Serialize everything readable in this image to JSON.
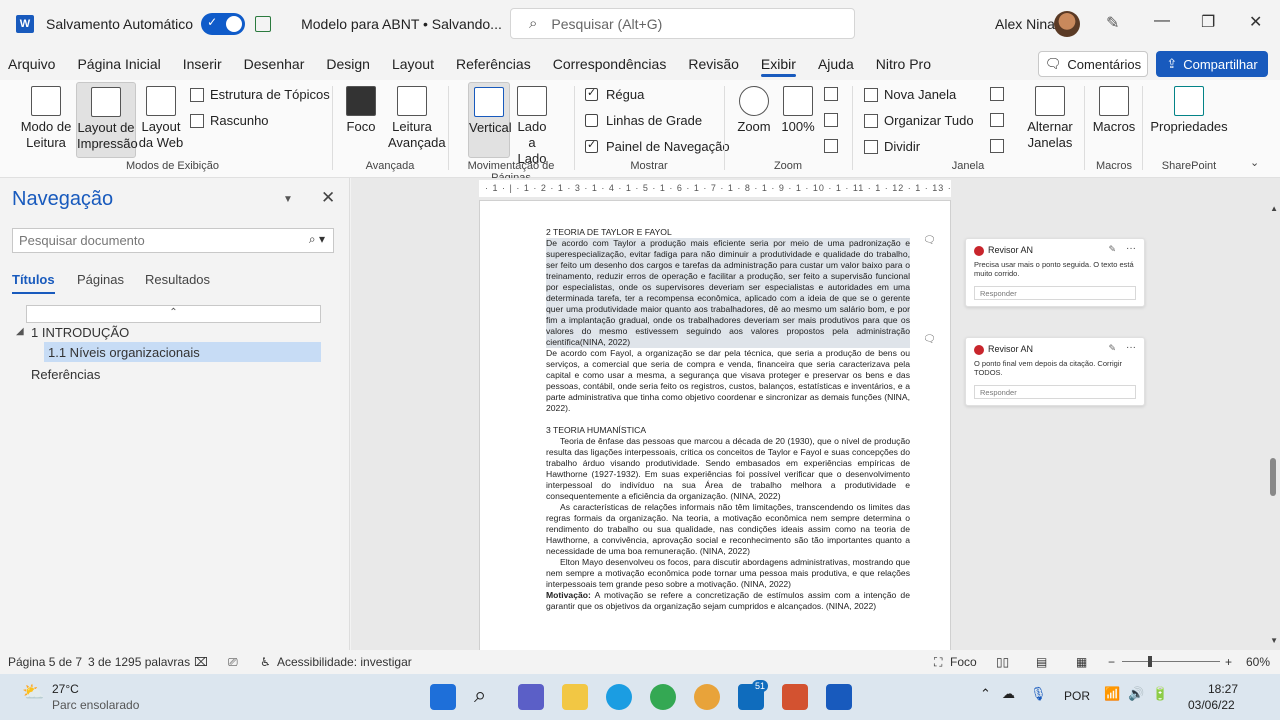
{
  "titlebar": {
    "app_icon": "word-icon",
    "app_letter": "W",
    "autosave_label": "Salvamento Automático",
    "doc_title": "Modelo para ABNT • Salvando...",
    "search_placeholder": "Pesquisar (Alt+G)",
    "user_name": "Alex Nina",
    "minimize": "—",
    "restore": "❐",
    "close": "✕"
  },
  "menu": {
    "tabs": [
      "Arquivo",
      "Página Inicial",
      "Inserir",
      "Desenhar",
      "Design",
      "Layout",
      "Referências",
      "Correspondências",
      "Revisão",
      "Exibir",
      "Ajuda",
      "Nitro Pro"
    ],
    "active_tab": "Exibir",
    "comments_label": "Comentários",
    "share_label": "Compartilhar",
    "accent_color": "#185abd"
  },
  "ribbon": {
    "modo_leitura": "Modo de Leitura",
    "layout_impressao": "Layout de Impressão",
    "layout_web": "Layout da Web",
    "estrutura_topicos": "Estrutura de Tópicos",
    "rascunho": "Rascunho",
    "grp_modos": "Modos de Exibição",
    "foco": "Foco",
    "leitura_avancada": "Leitura Avançada",
    "grp_avancada": "Avançada",
    "vertical": "Vertical",
    "lado_a_lado": "Lado a Lado",
    "grp_movimentacao": "Movimentação de Páginas",
    "regua": "Régua",
    "linhas_grade": "Linhas de Grade",
    "painel_navegacao": "Painel de Navegação",
    "grp_mostrar": "Mostrar",
    "zoom": "Zoom",
    "cem": "100%",
    "grp_zoom": "Zoom",
    "nova_janela": "Nova Janela",
    "organizar_tudo": "Organizar Tudo",
    "dividir": "Dividir",
    "alternar_janelas": "Alternar Janelas",
    "grp_janela": "Janela",
    "macros": "Macros",
    "grp_macros": "Macros",
    "propriedades": "Propriedades",
    "grp_sharepoint": "SharePoint"
  },
  "nav": {
    "title": "Navegação",
    "search_placeholder": "Pesquisar documento",
    "tabs": [
      "Títulos",
      "Páginas",
      "Resultados"
    ],
    "items": [
      {
        "label": "1 INTRODUÇÃO"
      },
      {
        "label": "1.1 Níveis organizacionais"
      },
      {
        "label": "Referências"
      }
    ]
  },
  "document": {
    "ruler_text": "· 1 · | · 1 · 2 · 1 · 3 · 1 · 4 · 1 · 5 · 1 · 6 · 1 · 7 · 1 · 8 · 1 · 9 · 1 · 10 · 1 · 11 · 1 · 12 · 1 · 13 · 1 · 14 · 1 · 15 ·",
    "h2": "2 TEORIA DE TAYLOR E FAYOL",
    "p1_highlighted": "De acordo com Taylor a produção mais eficiente seria por meio de uma padronização e superespecialização, evitar fadiga para não diminuir a produtividade e qualidade do trabalho, ser feito um desenho dos cargos e tarefas da administração para custar um valor baixo para o treinamento, reduzir erros de operação e facilitar a produção, ser feito a supervisão funcional por especialistas, onde os supervisores deveriam ser especialistas e autoridades em uma determinada tarefa, ter a recompensa econômica, aplicado com a ideia de que se o gerente quer uma produtividade maior quanto aos trabalhadores, dê ao mesmo um salário bom, e por fim a implantação gradual, onde os trabalhadores deveriam ser mais produtivos para que os valores do mesmo estivessem seguindo aos valores propostos pela administração científica(NINA, 2022)",
    "p2": "De acordo com Fayol, a organização se dar pela técnica, que seria a produção de bens ou serviços, a comercial que seria de compra e venda, financeira que seria caracterizava pela capital e como usar a mesma, a segurança que visava proteger e preservar os bens e das pessoas, contábil, onde seria feito os registros, custos, balanços, estatísticas e inventários, e a parte administrativa que tinha como objetivo coordenar e sincronizar as demais funções (NINA, 2022).",
    "h3": "3 TEORIA HUMANÍSTICA",
    "p3": "Teoria de ênfase das pessoas que marcou a década de 20 (1930), que o nível de produção resulta das ligações interpessoais, critica os conceitos de Taylor e Fayol e suas concepções do trabalho árduo visando produtividade. Sendo embasados em experiências empíricas de Hawthorne (1927-1932). Em suas experiências foi possível verificar que o desenvolvimento interpessoal do indivíduo na sua Área de trabalho melhora a produtividade e consequentemente a eficiência da organização. (NINA, 2022)",
    "p4": "As características de relações informais não têm limitações, transcendendo os limites das regras formais da organização. Na teoria, a motivação econômica nem sempre determina o rendimento do trabalho ou sua qualidade, nas condições ideais assim como na teoria de Hawthorne, a convivência, aprovação social e reconhecimento são tão importantes quanto a necessidade de uma boa remuneração. (NINA, 2022)",
    "p5": "Elton Mayo desenvolveu os focos, para discutir abordagens administrativas, mostrando que nem sempre a motivação econômica pode tornar uma pessoa mais produtiva, e que relações interpessoais tem grande peso sobre a motivação. (NINA, 2022)",
    "p6_bold": "Motivação:",
    "p6": " A motivação se refere a concretização de estímulos assim com a intenção de garantir que os objetivos da organização sejam cumpridos e alcançados. (NINA, 2022)",
    "comments": [
      {
        "author": "Revisor AN",
        "text": "Precisa usar mais o ponto seguida. O texto está muito corrido.",
        "reply": "Responder"
      },
      {
        "author": "Revisor AN",
        "text": "O ponto final vem depois da citação. Corrigir TODOS.",
        "reply": "Responder"
      }
    ]
  },
  "status": {
    "page": "Página 5 de 7",
    "words": "3 de 1295 palavras",
    "accessibility": "Acessibilidade: investigar",
    "focus": "Foco",
    "zoom": "60%"
  },
  "taskbar": {
    "weather_temp": "27°C",
    "weather_desc": "Parc ensolarado",
    "lang": "POR",
    "time": "18:27",
    "date": "03/06/22",
    "badge": "51"
  }
}
